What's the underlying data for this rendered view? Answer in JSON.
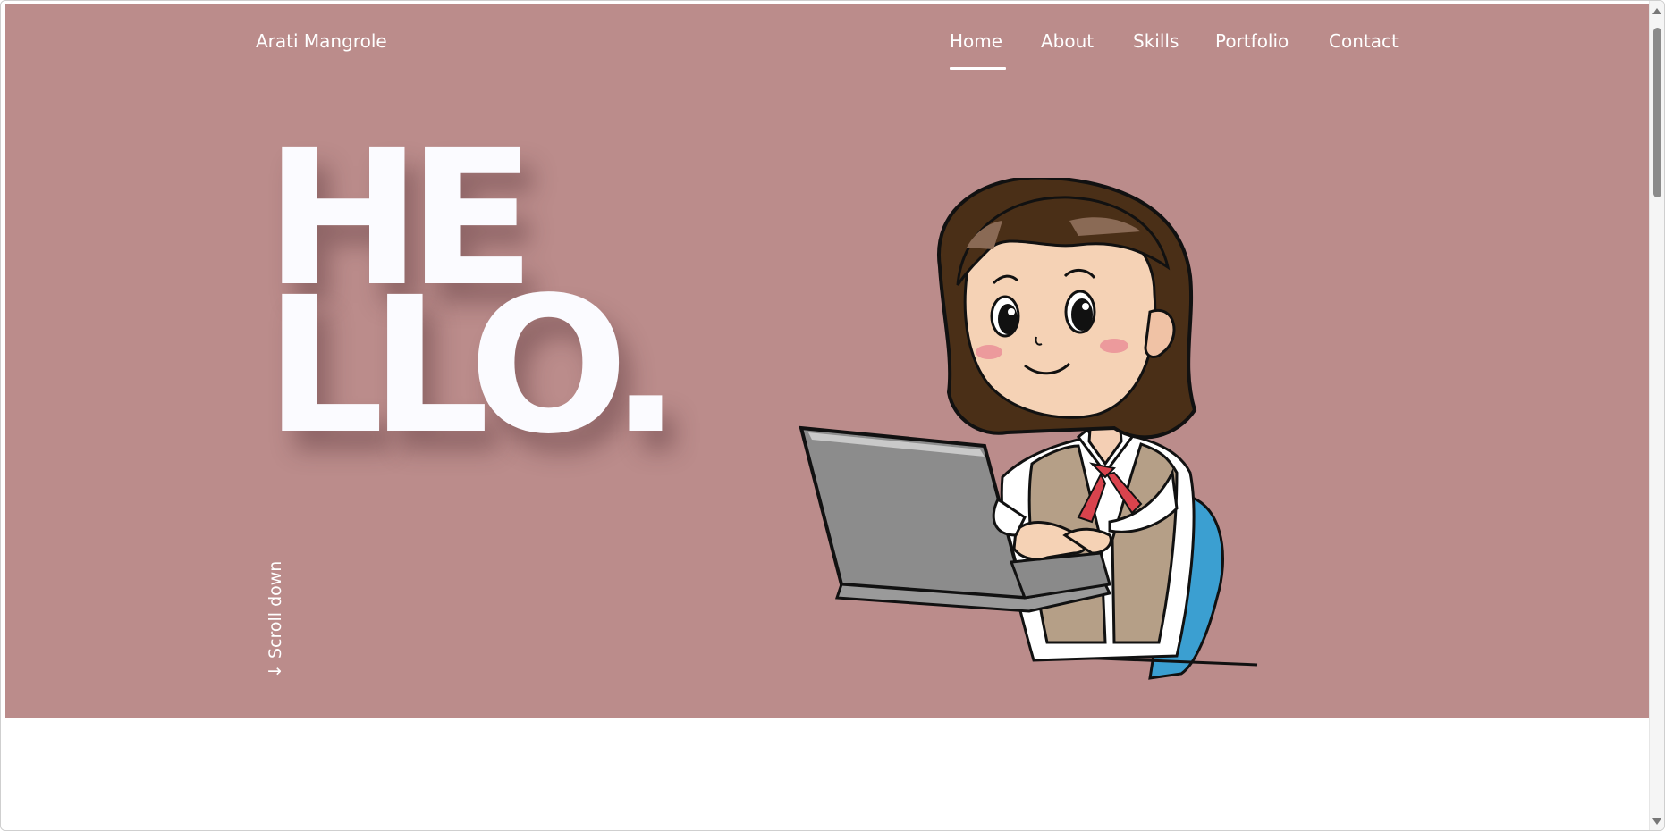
{
  "header": {
    "brand": "Arati Mangrole",
    "nav": [
      {
        "label": "Home",
        "active": true
      },
      {
        "label": "About",
        "active": false
      },
      {
        "label": "Skills",
        "active": false
      },
      {
        "label": "Portfolio",
        "active": false
      },
      {
        "label": "Contact",
        "active": false
      }
    ]
  },
  "hero": {
    "hello_line1": "HE",
    "hello_line2": "LLO.",
    "scroll_down": "↓ Scroll down",
    "illustration": "woman-at-laptop-illustration",
    "background_color": "#bb8c8b"
  },
  "colors": {
    "hero_background": "#bb8c8b",
    "text": "#ffffff",
    "page_background": "#ffffff"
  }
}
